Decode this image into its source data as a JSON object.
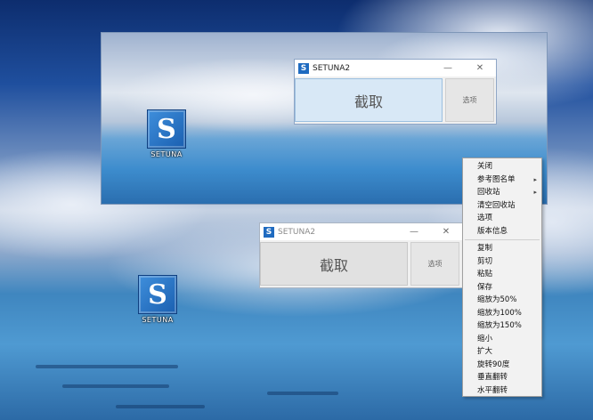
{
  "apps": [
    {
      "title": "SETUNA2",
      "logo": "S",
      "capture_label": "截取",
      "option_label": "选项",
      "minimize_glyph": "—",
      "close_glyph": "✕",
      "state": "active"
    },
    {
      "title": "SETUNA2",
      "logo": "S",
      "capture_label": "截取",
      "option_label": "选项",
      "minimize_glyph": "—",
      "close_glyph": "✕",
      "state": "inactive"
    }
  ],
  "desktop_icon": {
    "label": "SETUNA",
    "glyph": "S"
  },
  "context_menu": {
    "items": [
      {
        "label": "关闭"
      },
      {
        "label": "参考图名单",
        "submenu": true
      },
      {
        "label": "回收站",
        "submenu": true
      },
      {
        "label": "清空回收站"
      },
      {
        "label": "选项"
      },
      {
        "label": "版本信息"
      },
      {
        "separator": true
      },
      {
        "label": "复制"
      },
      {
        "label": "剪切"
      },
      {
        "label": "粘贴"
      },
      {
        "label": "保存"
      },
      {
        "label": "缩放为50%"
      },
      {
        "label": "缩放为100%"
      },
      {
        "label": "缩放为150%"
      },
      {
        "label": "缩小"
      },
      {
        "label": "扩大"
      },
      {
        "label": "旋转90度"
      },
      {
        "label": "垂直翻转"
      },
      {
        "label": "水平翻转"
      }
    ]
  },
  "colors": {
    "accent": "#1f6bc0",
    "active_capture_bg": "#d8e8f6"
  }
}
